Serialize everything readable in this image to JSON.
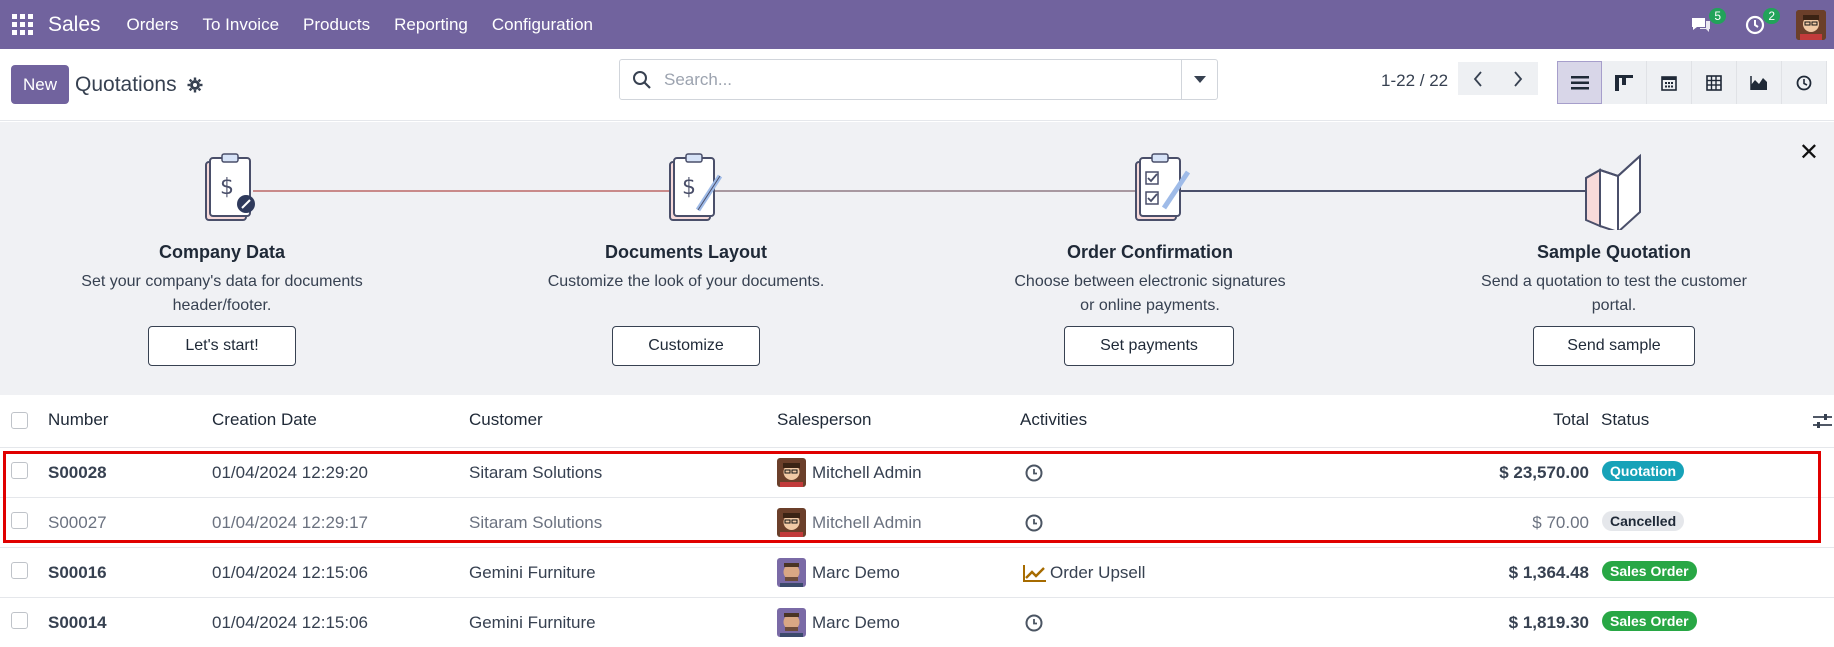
{
  "navbar": {
    "brand": "Sales",
    "menu": [
      "Orders",
      "To Invoice",
      "Products",
      "Reporting",
      "Configuration"
    ],
    "messages_count": "5",
    "activities_count": "2"
  },
  "control": {
    "new_label": "New",
    "title": "Quotations",
    "search_placeholder": "Search...",
    "pager": "1-22 / 22"
  },
  "onboarding": {
    "steps": [
      {
        "title": "Company Data",
        "desc_line1": "Set your company's data for documents",
        "desc_line2": "header/footer.",
        "button": "Let's start!"
      },
      {
        "title": "Documents Layout",
        "desc_line1": "Customize the look of your documents.",
        "desc_line2": "",
        "button": "Customize"
      },
      {
        "title": "Order Confirmation",
        "desc_line1": "Choose between electronic signatures",
        "desc_line2": "or online payments.",
        "button": "Set payments"
      },
      {
        "title": "Sample Quotation",
        "desc_line1": "Send a quotation to test the customer",
        "desc_line2": "portal.",
        "button": "Send sample"
      }
    ],
    "close": "✕"
  },
  "table": {
    "headers": {
      "number": "Number",
      "date": "Creation Date",
      "customer": "Customer",
      "salesperson": "Salesperson",
      "activities": "Activities",
      "total": "Total",
      "status": "Status"
    },
    "rows": [
      {
        "number": "S00028",
        "date": "01/04/2024 12:29:20",
        "customer": "Sitaram Solutions",
        "salesperson": "Mitchell Admin",
        "activity": "",
        "total": "$ 23,570.00",
        "status": "Quotation"
      },
      {
        "number": "S00027",
        "date": "01/04/2024 12:29:17",
        "customer": "Sitaram Solutions",
        "salesperson": "Mitchell Admin",
        "activity": "",
        "total": "$ 70.00",
        "status": "Cancelled"
      },
      {
        "number": "S00016",
        "date": "01/04/2024 12:15:06",
        "customer": "Gemini Furniture",
        "salesperson": "Marc Demo",
        "activity": "Order Upsell",
        "total": "$ 1,364.48",
        "status": "Sales Order"
      },
      {
        "number": "S00014",
        "date": "01/04/2024 12:15:06",
        "customer": "Gemini Furniture",
        "salesperson": "Marc Demo",
        "activity": "",
        "total": "$ 1,819.30",
        "status": "Sales Order"
      }
    ]
  },
  "colors": {
    "navbar": "#71639e",
    "quotation": "#17a2b8",
    "sales_order": "#28a745",
    "highlight": "#e00000"
  }
}
